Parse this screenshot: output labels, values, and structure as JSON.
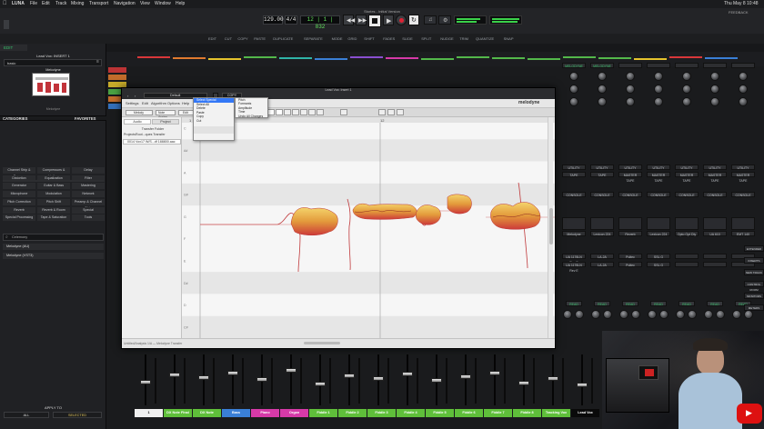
{
  "mac_menu": {
    "app": "LUNA",
    "items": [
      "File",
      "Edit",
      "Track",
      "Mixing",
      "Transport",
      "Navigation",
      "View",
      "Window",
      "Help"
    ],
    "clock": "Thu May 8  10:48"
  },
  "window": {
    "title": "Stories - Initial Version"
  },
  "transport": {
    "tempo": "129.00",
    "meter": "4/4",
    "position": "12 | 1 | 832",
    "shift_label": "SHIFT",
    "tape_label": "TAPE",
    "record_label": "FEEDBACK"
  },
  "tool_row": [
    "EDIT",
    "CUT",
    "COPY",
    "PASTE",
    "DUPLICATE",
    "SEPARATE",
    "MODE",
    "GRID",
    "SHIFT",
    "FADES",
    "SLIDE",
    "SPLIT",
    "NUDGE",
    "TRIM",
    "QUANTIZE",
    "SNAP"
  ],
  "left_panel": {
    "edit_label": "EDIT",
    "insert_title": "Lead Vox: INSERT 1",
    "preset_label": "basic",
    "plugin_name": "Melodyne",
    "plugin_status": "Melodyne",
    "categories_label": "CATEGORIES",
    "favorites_label": "FAVORITES",
    "categories": [
      "Channel Strip & Preamp",
      "Compressors & Limiters",
      "Delay",
      "Distortion",
      "Equalization",
      "Filter",
      "Generator",
      "Guitar & Bass",
      "Mastering",
      "Microphone",
      "Modulation",
      "Network",
      "Pitch Correction",
      "Pitch Shift",
      "Preamp & Channel Strip",
      "Reverb",
      "Reverb & Room",
      "Special",
      "Special Processing",
      "Tape & Saturation",
      "Tools"
    ],
    "search_placeholder": "Celemony",
    "results": [
      "Melodyne (AU)",
      "Melodyne (VST3)"
    ],
    "apply_label": "APPLY TO",
    "apply_all": "ALL",
    "apply_selected": "SELECTED"
  },
  "melodyne": {
    "window_title": "Lead Vox: Insert 1",
    "preset": "Default",
    "compare": "COPY",
    "menu": [
      "Settings",
      "Edit",
      "Algorithm",
      "Options",
      "Help"
    ],
    "brand": "melodyne",
    "tab_note": "Melody",
    "tab_audio": "Note Assign",
    "tab_edit": "Edit",
    "side_tabs": [
      "Audio",
      "Project"
    ],
    "side_items": [
      "Transfer Folder",
      "ProjectsRoot...ques Transfer"
    ],
    "file_item": "0014 Vox17 W/S...df 188800.aac",
    "note_labels": [
      "C",
      "A#",
      "A",
      "G#",
      "G",
      "F",
      "E",
      "D#",
      "D",
      "C#"
    ],
    "bar_labels": [
      "1",
      "12"
    ],
    "context_menu": [
      "Select Special",
      "Select All",
      "Delete",
      "Paste",
      "Copy",
      "Cut"
    ],
    "submenu": [
      "Pitch",
      "Formants",
      "Amplitude",
      "Time",
      "Undo All Changes"
    ],
    "footer": "Untitled/Analysis 1/A — Melodyne Transfer"
  },
  "mixer": {
    "strip_headers": [
      "MELODYNE",
      "MELODYNE"
    ],
    "utility_label": "UTILITY",
    "tape_label": "TAPE",
    "master_label": "MASTER TAPE",
    "console_label": "CONSOLE",
    "read_label": "READ",
    "plugin_slots": [
      "Melodyne",
      "Lexicon 224",
      "Reverb",
      "Lexicon 224",
      "Opto Opt Dly",
      "UA 610",
      "EMT 140",
      "Helios 69"
    ],
    "inserts": [
      "UA 1176LN Rev E",
      "LA-2A",
      "Pultec",
      "SSL G"
    ]
  },
  "right_buttons": [
    "EXTENDED",
    "INSERTS",
    "NEW TRACK",
    "CONTROL ROOM",
    "MONITORS",
    "METERS"
  ],
  "channels": [
    {
      "name": "1",
      "color": "#f0f0f0",
      "text": "#111"
    },
    {
      "name": "DX Note FInal",
      "color": "#5fbf3a",
      "text": "#fff"
    },
    {
      "name": "DX Note",
      "color": "#5fbf3a",
      "text": "#fff"
    },
    {
      "name": "Bass",
      "color": "#3a7fd6",
      "text": "#fff"
    },
    {
      "name": "Piano",
      "color": "#d63aa8",
      "text": "#fff"
    },
    {
      "name": "Organ",
      "color": "#d63aa8",
      "text": "#fff"
    },
    {
      "name": "Fiddle 1",
      "color": "#5fbf3a",
      "text": "#fff"
    },
    {
      "name": "Fiddle 2",
      "color": "#5fbf3a",
      "text": "#fff"
    },
    {
      "name": "Fiddle 3",
      "color": "#5fbf3a",
      "text": "#fff"
    },
    {
      "name": "Fiddle 4",
      "color": "#5fbf3a",
      "text": "#fff"
    },
    {
      "name": "Fiddle 5",
      "color": "#5fbf3a",
      "text": "#fff"
    },
    {
      "name": "Fiddle 6",
      "color": "#5fbf3a",
      "text": "#fff"
    },
    {
      "name": "Fiddle 7",
      "color": "#5fbf3a",
      "text": "#fff"
    },
    {
      "name": "Fiddle 8",
      "color": "#5fbf3a",
      "text": "#fff"
    },
    {
      "name": "Tracking Vox",
      "color": "#5fbf3a",
      "text": "#fff"
    },
    {
      "name": "Lead Vox",
      "color": "#0a0a0a",
      "text": "#fff"
    }
  ]
}
